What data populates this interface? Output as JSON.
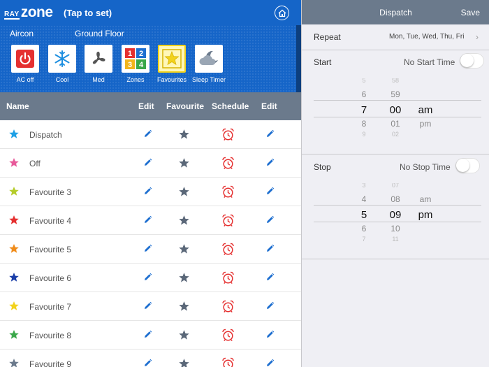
{
  "header": {
    "logo_small": "RAY",
    "logo_big": "zone",
    "tap_label": "(Tap to set)",
    "home_icon": "house-icon"
  },
  "controls": {
    "mode_label": "Aircon",
    "zone_label": "Ground Floor",
    "buttons": [
      {
        "label": "AC off",
        "icon": "power-icon"
      },
      {
        "label": "Cool",
        "icon": "snowflake-icon"
      },
      {
        "label": "Med",
        "icon": "fan-icon"
      },
      {
        "label": "Zones",
        "icon": "zones-grid-icon"
      },
      {
        "label": "Favourites",
        "icon": "star-icon"
      },
      {
        "label": "Sleep Timer",
        "icon": "moon-cloud-icon"
      }
    ]
  },
  "table": {
    "headers": [
      "Name",
      "Edit",
      "Favourite",
      "Schedule",
      "Edit"
    ],
    "rows": [
      {
        "name": "Dispatch",
        "color": "#1ea0e6"
      },
      {
        "name": "Off",
        "color": "#e85a9a"
      },
      {
        "name": "Favourite 3",
        "color": "#b5cc2a"
      },
      {
        "name": "Favourite 4",
        "color": "#e53030"
      },
      {
        "name": "Favourite 5",
        "color": "#f08c1a"
      },
      {
        "name": "Favourite 6",
        "color": "#1a3ea8"
      },
      {
        "name": "Favourite 7",
        "color": "#f2d21c"
      },
      {
        "name": "Favourite 8",
        "color": "#3aa84a"
      },
      {
        "name": "Favourite 9",
        "color": "#6b7a8c"
      }
    ]
  },
  "detail": {
    "title": "Dispatch",
    "save_label": "Save",
    "repeat_label": "Repeat",
    "repeat_value": "Mon, Tue, Wed, Thu, Fri",
    "start_label": "Start",
    "start_note": "No Start Time",
    "stop_label": "Stop",
    "stop_note": "No Stop Time",
    "start_picker": {
      "hours": [
        "5",
        "6",
        "7",
        "8",
        "9"
      ],
      "minutes": [
        "58",
        "59",
        "00",
        "01",
        "02"
      ],
      "ampm": [
        "",
        "",
        "am",
        "pm",
        ""
      ]
    },
    "stop_picker": {
      "hours": [
        "3",
        "4",
        "5",
        "6",
        "7"
      ],
      "minutes": [
        "07",
        "08",
        "09",
        "10",
        "11"
      ],
      "ampm": [
        "",
        "am",
        "pm",
        "",
        ""
      ]
    }
  },
  "colors": {
    "header_blue": "#1565c8",
    "table_header": "#6b7a8c",
    "icon_blue": "#1e6fd0",
    "alarm_red": "#e53030"
  }
}
